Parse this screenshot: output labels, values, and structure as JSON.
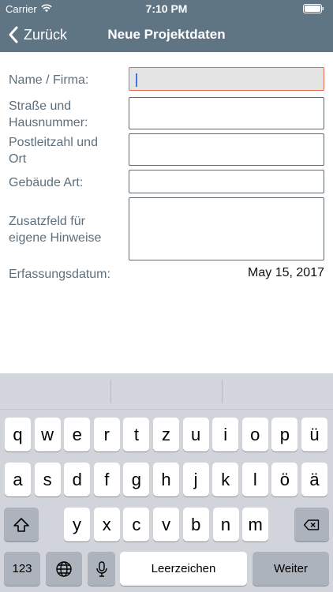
{
  "status": {
    "carrier": "Carrier",
    "time": "7:10 PM"
  },
  "nav": {
    "back_label": "Zurück",
    "title": "Neue Projektdaten"
  },
  "form": {
    "labels": {
      "name": "Name / Firma:",
      "street_line1": "Straße und",
      "street_line2": "Hausnummer:",
      "postal_line1": "Postleitzahl und",
      "postal_line2": "Ort",
      "building": "Gebäude Art:",
      "extra_line1": "Zusatzfeld für",
      "extra_line2": "eigene Hinweise",
      "date": "Erfassungsdatum:"
    },
    "date_value": "May 15, 2017"
  },
  "keyboard": {
    "row1": [
      "q",
      "w",
      "e",
      "r",
      "t",
      "z",
      "u",
      "i",
      "o",
      "p",
      "ü"
    ],
    "row2": [
      "a",
      "s",
      "d",
      "f",
      "g",
      "h",
      "j",
      "k",
      "l",
      "ö",
      "ä"
    ],
    "row3": [
      "y",
      "x",
      "c",
      "v",
      "b",
      "n",
      "m"
    ],
    "numbers_label": "123",
    "space_label": "Leerzeichen",
    "return_label": "Weiter"
  },
  "colors": {
    "nav_bg": "#5f7584",
    "label": "#5d6f7c",
    "active_border": "#e56a4e",
    "caret": "#3f74e6"
  }
}
